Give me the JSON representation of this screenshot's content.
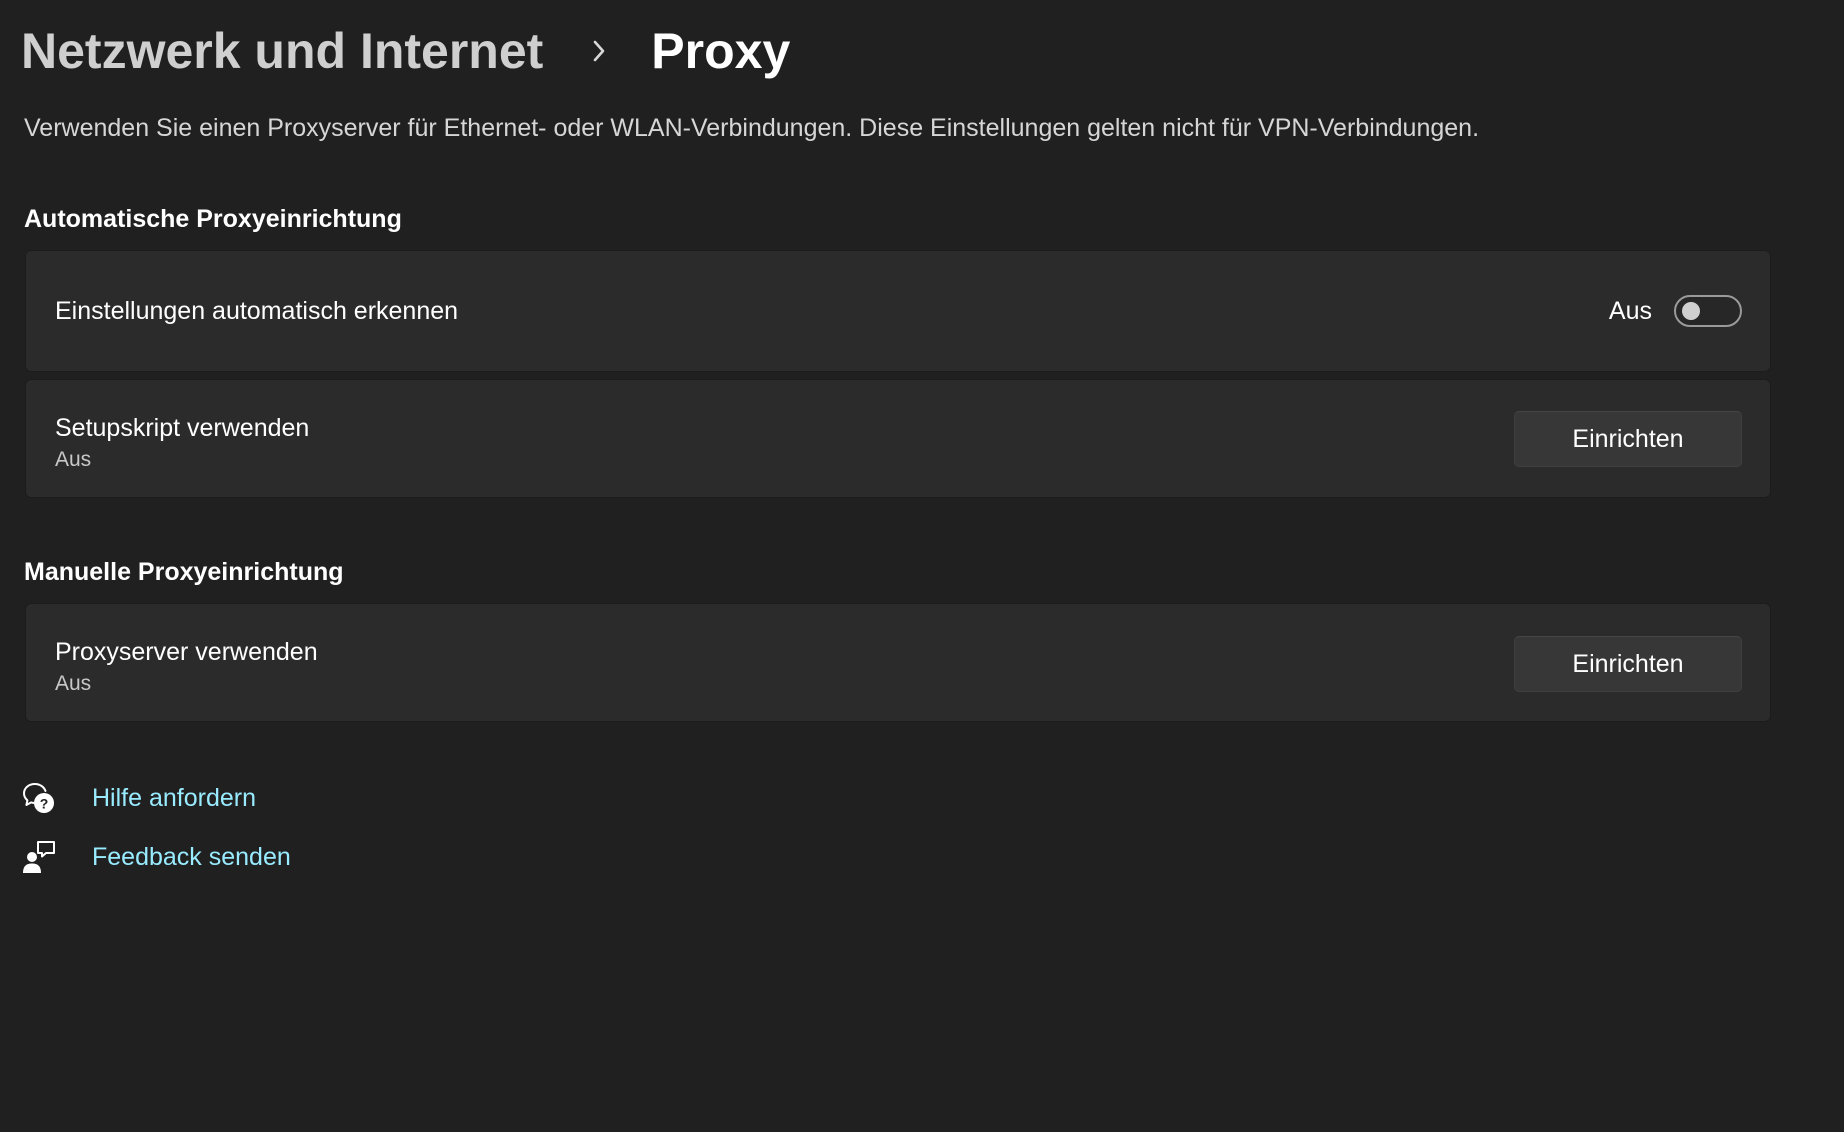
{
  "header": {
    "parent": "Netzwerk und Internet",
    "current": "Proxy"
  },
  "description": "Verwenden Sie einen Proxyserver für Ethernet- oder WLAN-Verbindungen. Diese Einstellungen gelten nicht für VPN-Verbindungen.",
  "auto_section": {
    "title": "Automatische Proxyeinrichtung",
    "detect": {
      "label": "Einstellungen automatisch erkennen",
      "status": "Aus",
      "enabled": false
    },
    "script": {
      "label": "Setupskript verwenden",
      "status": "Aus",
      "button": "Einrichten"
    }
  },
  "manual_section": {
    "title": "Manuelle Proxyeinrichtung",
    "proxy": {
      "label": "Proxyserver verwenden",
      "status": "Aus",
      "button": "Einrichten"
    }
  },
  "links": {
    "help": {
      "label": "Hilfe anfordern",
      "icon": "help-chat-icon"
    },
    "feedback": {
      "label": "Feedback senden",
      "icon": "feedback-icon"
    }
  },
  "colors": {
    "background": "#202020",
    "card": "#2b2b2b",
    "link": "#99ebff"
  }
}
